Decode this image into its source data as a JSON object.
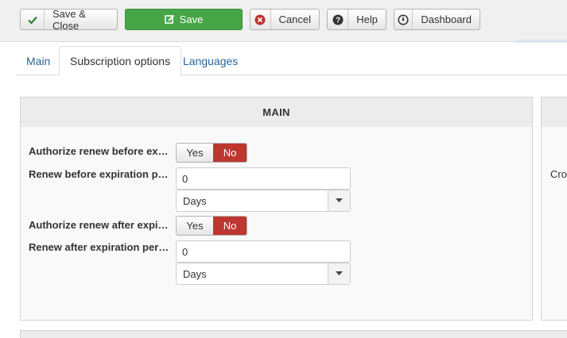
{
  "toolbar": {
    "save_close_label": "Save & Close",
    "save_label": "Save",
    "cancel_label": "Cancel",
    "help_label": "Help",
    "dashboard_label": "Dashboard"
  },
  "tabs": [
    {
      "label": "Main",
      "active": false
    },
    {
      "label": "Subscription options",
      "active": true
    },
    {
      "label": "Languages",
      "active": false
    }
  ],
  "panel": {
    "title": "MAIN",
    "fields": {
      "authorize_before": {
        "label": "Authorize renew before expiration",
        "yes": "Yes",
        "no": "No",
        "selected": "No"
      },
      "renew_before": {
        "label": "Renew before expiration period",
        "value": "0",
        "unit": "Days"
      },
      "authorize_after": {
        "label": "Authorize renew after expiration",
        "yes": "Yes",
        "no": "No",
        "selected": "No"
      },
      "renew_after": {
        "label": "Renew after expiration period",
        "value": "0",
        "unit": "Days"
      }
    }
  },
  "right_panel": {
    "partial_text": "Cro"
  },
  "colors": {
    "success": "#46a546",
    "danger": "#bd362f",
    "link": "#2a6496"
  },
  "icons": {
    "save_close": "check-icon",
    "save": "edit-icon",
    "cancel": "cancel-circle-icon",
    "help": "question-circle-icon",
    "dashboard": "dashboard-icon"
  }
}
